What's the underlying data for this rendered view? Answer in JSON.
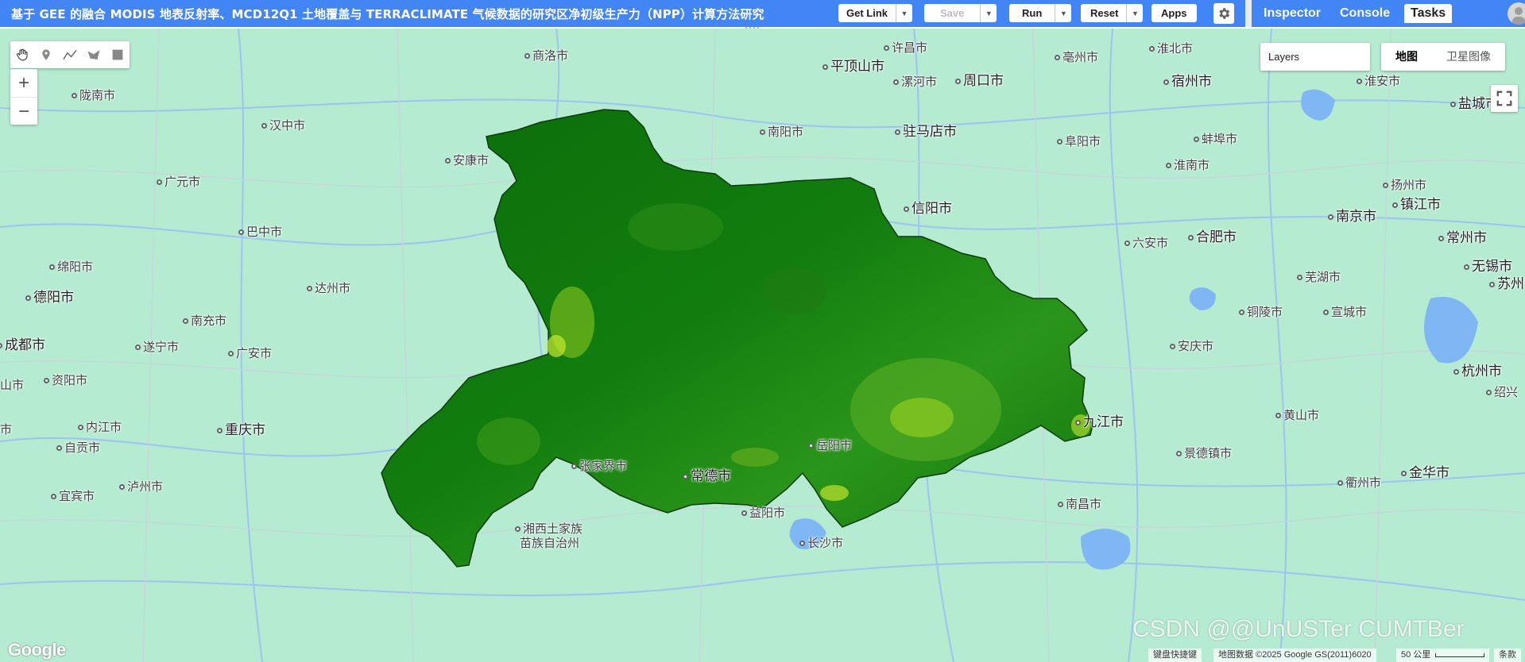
{
  "header": {
    "title": "基于 GEE 的融合 MODIS 地表反射率、MCD12Q1 土地覆盖与 TERRACLIMATE 气候数据的研究区净初级生产力（NPP）计算方法研究",
    "get_link_label": "Get Link",
    "save_label": "Save",
    "run_label": "Run",
    "reset_label": "Reset",
    "apps_label": "Apps"
  },
  "panel_tabs": [
    {
      "label": "Inspector",
      "active": false
    },
    {
      "label": "Console",
      "active": false
    },
    {
      "label": "Tasks",
      "active": true
    }
  ],
  "map": {
    "layers_label": "Layers",
    "map_type": {
      "map_label": "地图",
      "satellite_label": "卫星图像",
      "selected": "map"
    },
    "google_logo": "Google",
    "attribution": {
      "keyboard": "键盘快捷键",
      "data": "地图数据 ©2025 Google GS(2011)6020",
      "scale": "50 公里",
      "terms": "条款"
    },
    "watermark": "CSDN @@UnUSTer CUMTBer",
    "cities": [
      {
        "name": "许昌市",
        "major": false
      },
      {
        "name": "淮北市",
        "major": false
      },
      {
        "name": "商洛市",
        "major": false
      },
      {
        "name": "平顶山市",
        "major": true
      },
      {
        "name": "漯河市",
        "major": false
      },
      {
        "name": "周口市",
        "major": true
      },
      {
        "name": "亳州市",
        "major": false
      },
      {
        "name": "宿州市",
        "major": true
      },
      {
        "name": "淮安市",
        "major": false
      },
      {
        "name": "盐城市",
        "major": true
      },
      {
        "name": "陇南市",
        "major": false
      },
      {
        "name": "汉中市",
        "major": false
      },
      {
        "name": "南阳市",
        "major": false
      },
      {
        "name": "驻马店市",
        "major": true
      },
      {
        "name": "阜阳市",
        "major": false
      },
      {
        "name": "蚌埠市",
        "major": false
      },
      {
        "name": "安康市",
        "major": false
      },
      {
        "name": "淮南市",
        "major": false
      },
      {
        "name": "扬州市",
        "major": false
      },
      {
        "name": "广元市",
        "major": false
      },
      {
        "name": "镇江市",
        "major": true
      },
      {
        "name": "信阳市",
        "major": true
      },
      {
        "name": "南京市",
        "major": true
      },
      {
        "name": "巴中市",
        "major": false
      },
      {
        "name": "合肥市",
        "major": true
      },
      {
        "name": "常州市",
        "major": true
      },
      {
        "name": "六安市",
        "major": false
      },
      {
        "name": "绵阳市",
        "major": false
      },
      {
        "name": "无锡市",
        "major": true
      },
      {
        "name": "芜湖市",
        "major": false
      },
      {
        "name": "苏州",
        "major": true
      },
      {
        "name": "达州市",
        "major": false
      },
      {
        "name": "德阳市",
        "major": true
      },
      {
        "name": "铜陵市",
        "major": false
      },
      {
        "name": "宣城市",
        "major": false
      },
      {
        "name": "南充市",
        "major": false
      },
      {
        "name": "成都市",
        "major": true
      },
      {
        "name": "遂宁市",
        "major": false
      },
      {
        "name": "广安市",
        "major": false
      },
      {
        "name": "安庆市",
        "major": false
      },
      {
        "name": "杭州市",
        "major": true
      },
      {
        "name": "资阳市",
        "major": false
      },
      {
        "name": "山市",
        "major": false
      },
      {
        "name": "绍兴",
        "major": false
      },
      {
        "name": "九江市",
        "major": true
      },
      {
        "name": "黄山市",
        "major": false
      },
      {
        "name": "内江市",
        "major": false
      },
      {
        "name": "重庆市",
        "major": true
      },
      {
        "name": "市",
        "major": false
      },
      {
        "name": "岳阳市",
        "major": false
      },
      {
        "name": "自贡市",
        "major": false
      },
      {
        "name": "景德镇市",
        "major": false
      },
      {
        "name": "张家界市",
        "major": false
      },
      {
        "name": "常德市",
        "major": true
      },
      {
        "name": "金华市",
        "major": true
      },
      {
        "name": "宜宾市",
        "major": false
      },
      {
        "name": "泸州市",
        "major": false
      },
      {
        "name": "衢州市",
        "major": false
      },
      {
        "name": "益阳市",
        "major": false
      },
      {
        "name": "南昌市",
        "major": false
      },
      {
        "name": "湘西土家族",
        "major": false
      },
      {
        "name": "苗族自治州",
        "major": false
      },
      {
        "name": "长沙市",
        "major": false
      }
    ]
  },
  "icons": {
    "pan": "hand-icon",
    "point": "marker-icon",
    "line": "line-icon",
    "polygon": "polygon-icon",
    "rectangle": "rectangle-icon",
    "settings": "gear-icon",
    "fullscreen": "fullscreen-icon"
  },
  "colors": {
    "accent": "#4285f4",
    "map_land": "#b5ebd1",
    "npp_dark": "#0a6e0a",
    "npp_mid": "#1a8c12",
    "npp_light": "#9ad820"
  }
}
